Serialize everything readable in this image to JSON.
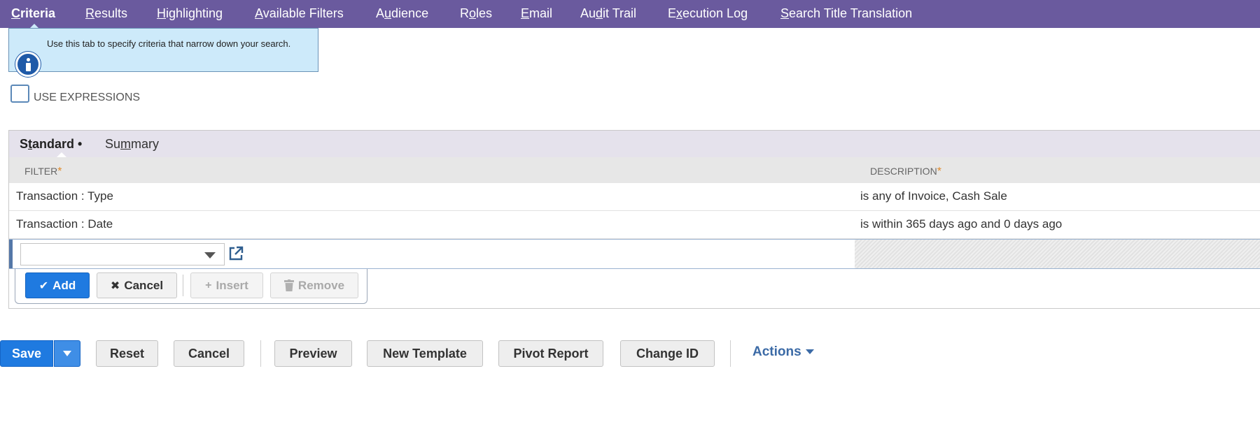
{
  "top_tabs": [
    {
      "pre": "",
      "key": "C",
      "post": "riteria",
      "active": true
    },
    {
      "pre": "",
      "key": "R",
      "post": "esults",
      "active": false
    },
    {
      "pre": "",
      "key": "H",
      "post": "ighlighting",
      "active": false
    },
    {
      "pre": "",
      "key": "A",
      "post": "vailable Filters",
      "active": false
    },
    {
      "pre": "A",
      "key": "u",
      "post": "dience",
      "active": false
    },
    {
      "pre": "R",
      "key": "o",
      "post": "les",
      "active": false
    },
    {
      "pre": "",
      "key": "E",
      "post": "mail",
      "active": false
    },
    {
      "pre": "Au",
      "key": "d",
      "post": "it Trail",
      "active": false
    },
    {
      "pre": "E",
      "key": "x",
      "post": "ecution Log",
      "active": false
    },
    {
      "pre": "",
      "key": "S",
      "post": "earch Title Translation",
      "active": false
    }
  ],
  "info": {
    "text": "Use this tab to specify criteria that narrow down your search.",
    "icon": "info-icon"
  },
  "use_expressions": {
    "label": "USE EXPRESSIONS",
    "checked": false
  },
  "subtabs": {
    "standard": {
      "pre": "S",
      "key": "t",
      "post": "andard •"
    },
    "summary": {
      "pre": "Su",
      "key": "m",
      "post": "mary"
    }
  },
  "columns": {
    "filter": "FILTER",
    "description": "DESCRIPTION",
    "required_mark": "*"
  },
  "rows": [
    {
      "filter": "Transaction : Type",
      "description": "is any of Invoice, Cash Sale"
    },
    {
      "filter": "Transaction : Date",
      "description": "is within 365 days ago and 0 days ago"
    }
  ],
  "edit_row": {
    "select_value": "",
    "open_icon": "external-link-icon"
  },
  "row_buttons": {
    "add": "Add",
    "cancel": "Cancel",
    "insert": "Insert",
    "remove": "Remove"
  },
  "bottom_buttons": {
    "save": "Save",
    "reset": "Reset",
    "cancel": "Cancel",
    "preview": "Preview",
    "new_template": "New Template",
    "pivot_report": "Pivot Report",
    "change_id": "Change ID",
    "actions": "Actions"
  },
  "colors": {
    "nav_bg": "#6a5a9e",
    "primary": "#1f7ae0",
    "info_bg": "#cdeafa",
    "link": "#3b6aa6",
    "required": "#e08a2b"
  }
}
